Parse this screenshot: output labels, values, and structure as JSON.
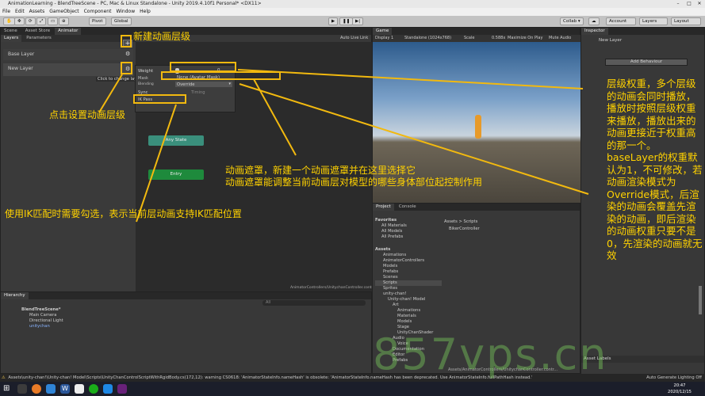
{
  "window": {
    "title": "AnimationLearning - BlendTreeScene - PC, Mac & Linux Standalone - Unity 2019.4.10f1 Personal* <DX11>"
  },
  "menu": [
    "File",
    "Edit",
    "Assets",
    "GameObject",
    "Component",
    "Window",
    "Help"
  ],
  "toolbar": {
    "pivot": "Pivot",
    "global": "Global",
    "collab": "Collab ▾",
    "account": "Account",
    "layers": "Layers",
    "layout": "Layout"
  },
  "animator": {
    "tabs": [
      "Scene",
      "Asset Store",
      "Animator"
    ],
    "subtabs": [
      "Layers",
      "Parameters"
    ],
    "auto_live": "Auto Live Link",
    "layers": [
      "Base Layer",
      "New Layer"
    ],
    "tooltip": "Click to change layer settings.",
    "settings": {
      "weight_label": "Weight",
      "weight_value": "0",
      "mask_value": "None (Avatar Mask)",
      "blending_label": "Blending",
      "blending_value": "Override",
      "sync_label": "Sync",
      "timing_label": "Timing",
      "ik_label": "IK Pass"
    },
    "states": {
      "any": "Any State",
      "entry": "Entry"
    },
    "footer_path": "AnimatorControllers/UnitychanController.controller"
  },
  "game": {
    "tab": "Game",
    "display": "Display 1",
    "resolution": "Standalone (1024x768)",
    "scale_label": "Scale",
    "scale_value": "0.588x",
    "maximize": "Maximize On Play",
    "mute": "Mute Audio"
  },
  "inspector": {
    "tab": "Inspector",
    "name": "New Layer",
    "add_behaviour": "Add Behaviour",
    "asset_labels": "Asset Labels"
  },
  "hierarchy": {
    "tab": "Hierarchy",
    "search_placeholder": "All",
    "items": [
      {
        "label": "BlendTreeScene*",
        "indent": 0
      },
      {
        "label": "Main Camera",
        "indent": 1
      },
      {
        "label": "Directional Light",
        "indent": 1
      },
      {
        "label": "unitychan",
        "indent": 1
      }
    ]
  },
  "project": {
    "tabs": [
      "Project",
      "Console"
    ],
    "favorites": [
      "Favorites",
      "All Materials",
      "All Models",
      "All Prefabs"
    ],
    "assets_tree": [
      "Assets",
      "Animations",
      "AnimatorControllers",
      "Models",
      "Prefabs",
      "Scenes",
      "Scripts",
      "Sprites",
      "unity-chan!",
      "Unity-chan! Model",
      "Art",
      "Animations",
      "Materials",
      "Models",
      "Stage",
      "UnityChanShader",
      "Audio",
      "Voice",
      "Documentation",
      "Editor",
      "Prefabs"
    ],
    "breadcrumb": "Assets > Scripts",
    "files": [
      "BikerController"
    ],
    "footer_path": "Assets/AnimatorControllers/UnitychanController.contr..."
  },
  "status": {
    "message": "Assets\\unity-chan!\\Unity-chan! Model\\Scripts\\UnityChanControlScriptWithRgidBody.cs(172,12): warning CS0618: 'AnimatorStateInfo.nameHash' is obsolete: 'AnimatorStateInfo.nameHash has been deprecated. Use AnimatorStateInfo.fullPathHash instead.'",
    "right": "Auto Generate Lighting Off"
  },
  "taskbar": {
    "time": "20:47",
    "date": "2020/12/15"
  },
  "watermark": "857vps.cn",
  "callouts": {
    "new_layer": "新建动画层级",
    "settings": "点击设置动画层级",
    "mask": "动画遮罩，新建一个动画遮罩并在这里选择它\n动画遮罩能调整当前动画层对模型的哪些身体部位起控制作用",
    "ik": "使用IK匹配时需要勾选，表示当前层动画支持IK匹配位置",
    "weight": "层级权重，多个层级的动画会同时播放，播放时按照层级权重来播放，播放出来的动画更接近于权重高的那一个。baseLayer的权重默认为1，不可修改，若动画渲染模式为Override模式，后渲染的动画会覆盖先渲染的动画，即后渲染的动画权重只要不是0，先渲染的动画就无效"
  },
  "colors": {
    "callout": "#ffd200",
    "box": "#f2b90f",
    "any_state": "#3a8f7c",
    "entry": "#1e8a3c",
    "sky": "#a9c0d8"
  }
}
